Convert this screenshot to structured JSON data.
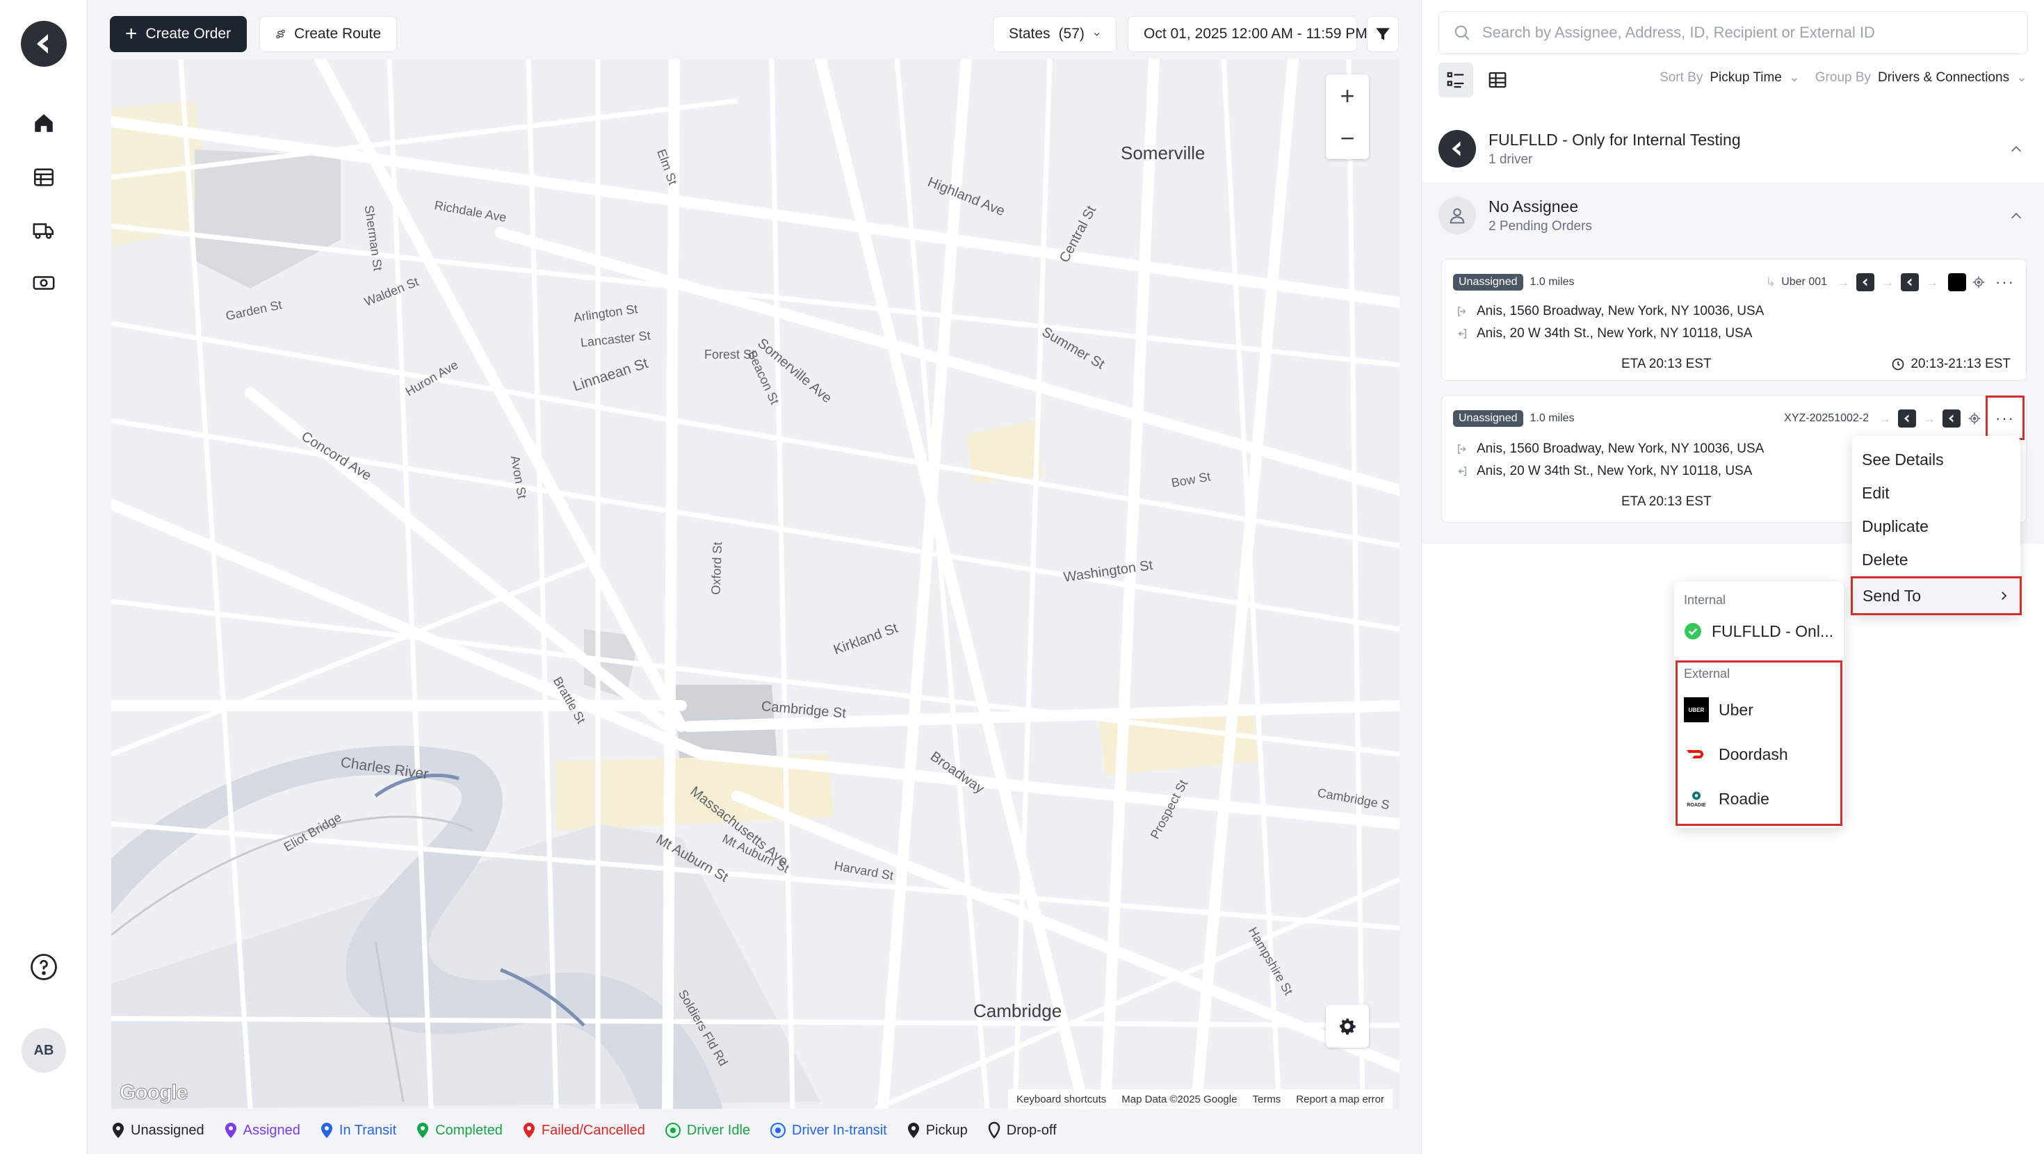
{
  "rail": {
    "avatar_initials": "AB"
  },
  "toolbar": {
    "create_order": "Create Order",
    "create_route": "Create Route",
    "states_label": "States",
    "states_count": "(57)",
    "date_range": "Oct 01, 2025 12:00 AM - 11:59 PM"
  },
  "map": {
    "labels": [
      "Somerville",
      "Cambridge",
      "Charles River",
      "Richdale Ave",
      "Walden St",
      "Garden St",
      "Arlington St",
      "Lancaster St",
      "Forest St",
      "Linnaean St",
      "Somerville Ave",
      "Beacon St",
      "Highland Ave",
      "Summer St",
      "Central St",
      "Washington St",
      "Cambridge St",
      "Broadway",
      "Massachusetts Ave",
      "Mt Auburn St",
      "Kirkland St",
      "Concord Ave",
      "Oxford St",
      "Elm St",
      "Hampshire St",
      "Prospect St",
      "Harvard St",
      "Soldiers Fld Rd",
      "Eliot Bridge",
      "Mt Auburn St",
      "Brattle St",
      "Huron Ave",
      "Avon St",
      "Sherman St",
      "Bow St",
      "Cambridge S"
    ],
    "zoom_in": "+",
    "zoom_out": "−",
    "attribution": [
      "Keyboard shortcuts",
      "Map Data ©2025 Google",
      "Terms",
      "Report a map error"
    ],
    "google": "Google"
  },
  "legend": [
    {
      "label": "Unassigned",
      "color": "#1f2328"
    },
    {
      "label": "Assigned",
      "color": "#7c3aed"
    },
    {
      "label": "In Transit",
      "color": "#2563eb"
    },
    {
      "label": "Completed",
      "color": "#16a34a"
    },
    {
      "label": "Failed/Cancelled",
      "color": "#dc2626"
    },
    {
      "label": "Driver Idle",
      "color": "#16a34a"
    },
    {
      "label": "Driver In-transit",
      "color": "#2563eb"
    },
    {
      "label": "Pickup",
      "color": "#1f2328"
    },
    {
      "label": "Drop-off",
      "color": "#1f2328"
    }
  ],
  "panel": {
    "search_placeholder": "Search by Assignee, Address, ID, Recipient or External ID",
    "sort_by_label": "Sort By",
    "sort_by_value": "Pickup Time",
    "group_by_label": "Group By",
    "group_by_value": "Drivers & Connections",
    "groups": [
      {
        "title": "FULFLLD - Only for Internal Testing",
        "subtitle": "1 driver"
      },
      {
        "title": "No Assignee",
        "subtitle": "2 Pending Orders"
      }
    ],
    "orders": [
      {
        "status": "Unassigned",
        "distance": "1.0 miles",
        "ref": "Uber 001",
        "pickup": "Anis, 1560 Broadway, New York, NY 10036, USA",
        "dropoff": "Anis, 20 W 34th St., New York, NY 10118, USA",
        "eta": "ETA 20:13 EST",
        "window": "20:13-21:13 EST"
      },
      {
        "status": "Unassigned",
        "distance": "1.0 miles",
        "ref": "XYZ-20251002-2",
        "pickup": "Anis, 1560 Broadway, New York, NY 10036, USA",
        "dropoff": "Anis, 20 W 34th St., New York, NY 10118, USA",
        "eta": "ETA 20:13 EST"
      }
    ]
  },
  "menu": {
    "items": [
      "See Details",
      "Edit",
      "Duplicate",
      "Delete"
    ],
    "send_to": "Send To"
  },
  "submenu": {
    "internal_header": "Internal",
    "internal_item": "FULFLLD - Onl...",
    "external_header": "External",
    "external_items": [
      "Uber",
      "Doordash",
      "Roadie"
    ],
    "uber_logo_text": "UBER",
    "roadie_logo_text": "ROADIE"
  },
  "colors": {
    "accent_red": "#d32f2f",
    "primary_dark": "#1e2530"
  }
}
